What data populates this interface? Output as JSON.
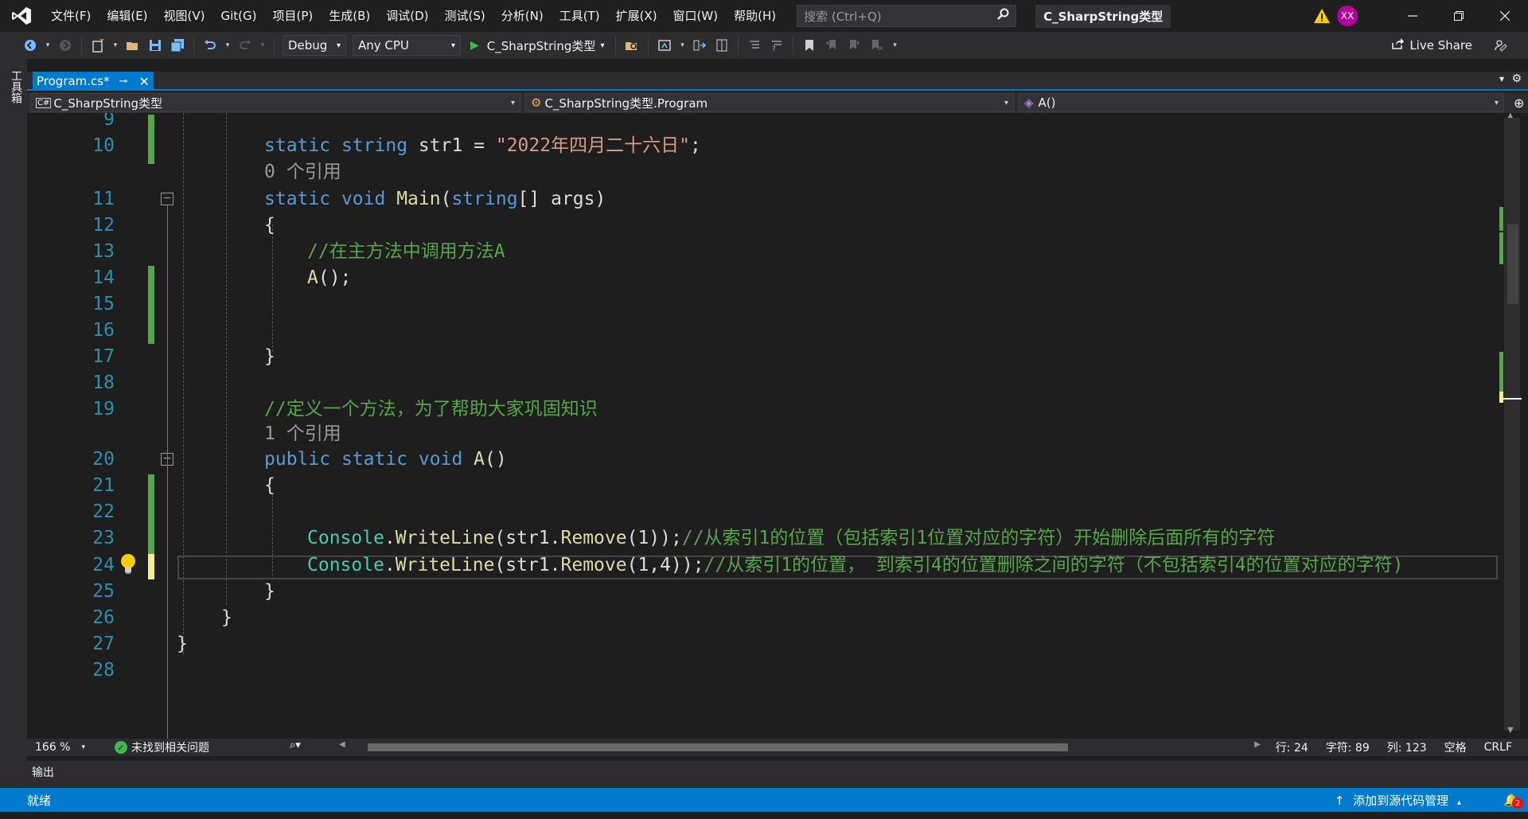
{
  "menu": {
    "items": [
      "文件(F)",
      "编辑(E)",
      "视图(V)",
      "Git(G)",
      "项目(P)",
      "生成(B)",
      "调试(D)",
      "测试(S)",
      "分析(N)",
      "工具(T)",
      "扩展(X)",
      "窗口(W)",
      "帮助(H)"
    ],
    "search_placeholder": "搜索 (Ctrl+Q)",
    "solution_name": "C_SharpString类型",
    "avatar_initials": "XX"
  },
  "toolbar": {
    "config": "Debug",
    "platform": "Any CPU",
    "run_target": "C_SharpString类型",
    "live_share": "Live Share"
  },
  "toolbox": {
    "label": "工具箱"
  },
  "tab": {
    "title": "Program.cs*"
  },
  "navbar": {
    "project": "C_SharpString类型",
    "class": "C_SharpString类型.Program",
    "member": "A()"
  },
  "code": {
    "line9": "9",
    "line10": "10",
    "line11": "11",
    "line12": "12",
    "line13": "13",
    "line14": "14",
    "line15": "15",
    "line16": "16",
    "line17": "17",
    "line18": "18",
    "line19": "19",
    "line20": "20",
    "line21": "21",
    "line22": "22",
    "line23": "23",
    "line24": "24",
    "line25": "25",
    "line26": "26",
    "line27": "27",
    "line28": "28",
    "l10_kw1": "static",
    "l10_kw2": "string",
    "l10_var": "str1",
    "l10_eq": " = ",
    "l10_str": "\"2022年四月二十六日\"",
    "l10_end": ";",
    "lens1": "0 个引用",
    "l11_kw1": "static",
    "l11_kw2": "void",
    "l11_fn": "Main",
    "l11_p1": "(",
    "l11_kw3": "string",
    "l11_p2": "[] ",
    "l11_arg": "args",
    "l11_p3": ")",
    "brace_open": "{",
    "brace_close": "}",
    "l13_cm": "//在主方法中调用方法A",
    "l14_fn": "A",
    "l14_rest": "();",
    "l19_cm": "//定义一个方法，为了帮助大家巩固知识",
    "lens2": "1 个引用",
    "l20_kw1": "public",
    "l20_kw2": "static",
    "l20_kw3": "void",
    "l20_fn": "A",
    "l20_rest": "()",
    "console": "Console",
    "dot": ".",
    "writeline": "WriteLine",
    "remove": "Remove",
    "l23_a": "(str1.",
    "l23_b": "(1));",
    "l23_cm": "//从索引1的位置（包括索引1位置对应的字符）开始删除后面所有的字符",
    "l24_b": "(1,4));",
    "l24_cm": "//从索引1的位置， 到索引4的位置删除之间的字符（不包括索引4的位置对应的字符)"
  },
  "status_editor": {
    "zoom": "166 %",
    "issues": "未找到相关问题",
    "line": "行: 24",
    "char": "字符: 89",
    "col": "列: 123",
    "indent": "空格",
    "eol": "CRLF"
  },
  "output": {
    "title": "输出"
  },
  "statusbar": {
    "ready": "就绪",
    "source_control": "添加到源代码管理",
    "notifications": "2"
  },
  "colors": {
    "accent": "#007acc",
    "keyword": "#569cd6",
    "string": "#d69d85",
    "comment": "#57a64a",
    "type": "#4ec9b0",
    "line_number": "#2b91af"
  }
}
